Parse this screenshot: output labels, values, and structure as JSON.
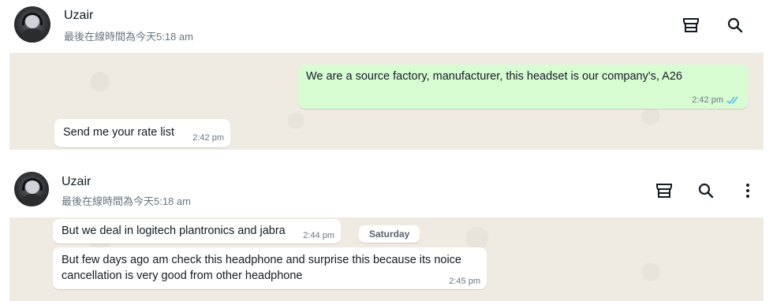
{
  "top": {
    "contact_name": "Uzair",
    "last_seen": "最後在線時間為今天5:18 am",
    "messages": [
      {
        "direction": "out",
        "text": "We are a source factory, manufacturer, this headset is our company's, A26",
        "time": "2:42 pm",
        "status": "read"
      },
      {
        "direction": "in",
        "text": "Send me your rate list",
        "time": "2:42 pm"
      }
    ]
  },
  "bottom": {
    "contact_name": "Uzair",
    "last_seen": "最後在線時間為今天5:18 am",
    "date_chip": "Saturday",
    "messages": [
      {
        "direction": "in",
        "text": "But we deal in logitech plantronics and jabra",
        "time": "2:44 pm"
      },
      {
        "direction": "in",
        "text": "But few days ago am check this headphone and surprise this because its noice cancellation is very good from other headphone",
        "time": "2:45 pm"
      }
    ]
  },
  "icons": {
    "shop": "shop-icon",
    "search": "search-icon",
    "menu": "more-vert-icon",
    "read_receipt": "double-check-icon"
  },
  "colors": {
    "outgoing_bubble": "#d9fdd3",
    "incoming_bubble": "#ffffff",
    "chat_background": "#efeae2",
    "read_tick": "#53bdeb"
  }
}
